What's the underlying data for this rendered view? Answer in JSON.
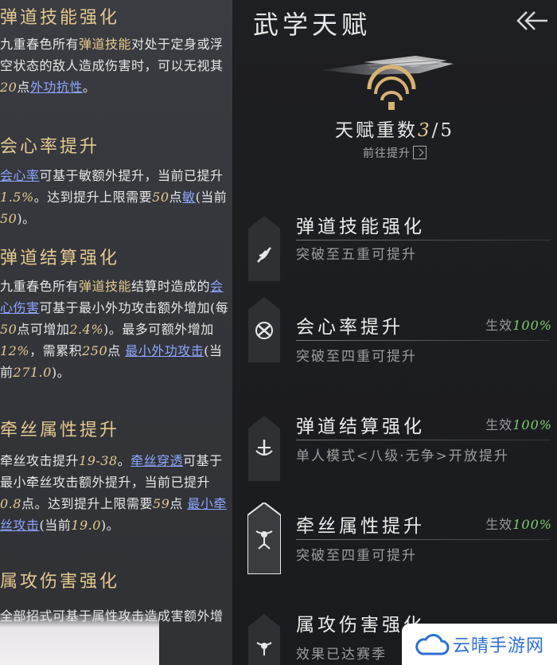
{
  "left": {
    "sections": [
      {
        "title": "弹道技能强化",
        "parts": [
          {
            "t": "九重春色所有",
            "c": ""
          },
          {
            "t": "弹道技能",
            "c": "gold"
          },
          {
            "t": "对处于定身或浮空状态的敌人造成伤害时，可以无视其",
            "c": ""
          },
          {
            "t": "20",
            "c": "num"
          },
          {
            "t": "点",
            "c": ""
          },
          {
            "t": "外功抗性",
            "c": "link"
          },
          {
            "t": "。",
            "c": ""
          }
        ]
      },
      {
        "title": "会心率提升",
        "parts": [
          {
            "t": "会心率",
            "c": "link"
          },
          {
            "t": "可基于敏额外提升，当前已提升",
            "c": ""
          },
          {
            "t": "1.5%",
            "c": "num"
          },
          {
            "t": "。达到提升上限需要",
            "c": ""
          },
          {
            "t": "50",
            "c": "num"
          },
          {
            "t": "点",
            "c": ""
          },
          {
            "t": "敏",
            "c": "link"
          },
          {
            "t": "(当前",
            "c": ""
          },
          {
            "t": "50",
            "c": "num"
          },
          {
            "t": ")。",
            "c": ""
          }
        ]
      },
      {
        "title": "弹道结算强化",
        "parts": [
          {
            "t": "九重春色所有",
            "c": ""
          },
          {
            "t": "弹道技能",
            "c": "gold"
          },
          {
            "t": "结算时造成的",
            "c": ""
          },
          {
            "t": "会心伤害",
            "c": "link"
          },
          {
            "t": "可基于最小外功攻击额外增加(每",
            "c": ""
          },
          {
            "t": "50",
            "c": "num"
          },
          {
            "t": "点可增加",
            "c": ""
          },
          {
            "t": "2.4%",
            "c": "num"
          },
          {
            "t": ")。最多可额外增加",
            "c": ""
          },
          {
            "t": "12%",
            "c": "num"
          },
          {
            "t": "，需累积",
            "c": ""
          },
          {
            "t": "250",
            "c": "num"
          },
          {
            "t": "点 ",
            "c": ""
          },
          {
            "t": "最小外功攻击",
            "c": "link"
          },
          {
            "t": "(当前",
            "c": ""
          },
          {
            "t": "271.0",
            "c": "num"
          },
          {
            "t": ")。",
            "c": ""
          }
        ]
      },
      {
        "title": "牵丝属性提升",
        "parts": [
          {
            "t": "牵丝攻击提升",
            "c": ""
          },
          {
            "t": "19-38",
            "c": "num"
          },
          {
            "t": "。",
            "c": ""
          },
          {
            "t": "牵丝穿透",
            "c": "link"
          },
          {
            "t": "可基于最小牵丝攻击额外提升，当前已提升",
            "c": ""
          },
          {
            "t": "0.8",
            "c": "num"
          },
          {
            "t": "点。达到提升上限需要",
            "c": ""
          },
          {
            "t": "59",
            "c": "num"
          },
          {
            "t": "点 ",
            "c": ""
          },
          {
            "t": "最小牵丝攻击",
            "c": "link"
          },
          {
            "t": "(当前",
            "c": ""
          },
          {
            "t": "19.0",
            "c": "num"
          },
          {
            "t": ")。",
            "c": ""
          }
        ]
      },
      {
        "title": "属攻伤害强化",
        "parts": [
          {
            "t": "全部招式可基于属性攻击造成",
            "c": ""
          },
          {
            "t": "害额外增",
            "c": ""
          }
        ]
      }
    ]
  },
  "right": {
    "title": "武学天赋",
    "talent_count_label": "天赋重数",
    "talent_current": "3",
    "talent_total": "/5",
    "goto_label": "前往提升",
    "talents": [
      {
        "name": "弹道技能强化",
        "effect_label": "",
        "effect_pct": "",
        "desc": "突破至五重可提升",
        "icon": "feather-icon"
      },
      {
        "name": "会心率提升",
        "effect_label": "生效",
        "effect_pct": "100%",
        "desc": "突破至四重可提升",
        "icon": "crit-burst-icon"
      },
      {
        "name": "弹道结算强化",
        "effect_label": "生效",
        "effect_pct": "100%",
        "desc": "单人模式<八级·无争>开放提升",
        "icon": "anchor-icon"
      },
      {
        "name": "牵丝属性提升",
        "effect_label": "生效",
        "effect_pct": "100%",
        "desc": "突破至四重可提升",
        "icon": "puppet-string-icon"
      },
      {
        "name": "属攻伤害强化",
        "effect_label": "",
        "effect_pct": "",
        "desc": "效果已达赛季",
        "icon": "element-icon"
      }
    ]
  },
  "watermark": {
    "text": "云晴手游网"
  },
  "colors": {
    "gold": "#e6c98e",
    "link": "#8ca6ff",
    "green": "#7ad06a",
    "panel_left": "#36383d",
    "panel_right": "#1b1c1f"
  }
}
